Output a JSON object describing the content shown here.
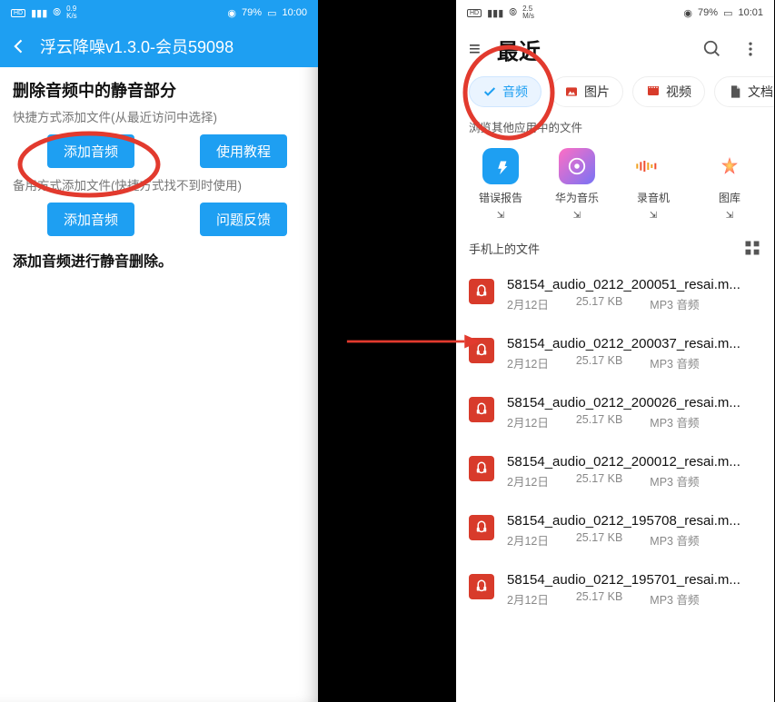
{
  "left_phone": {
    "status": {
      "speed_top": "0.9",
      "speed_bottom": "K/s",
      "battery": "79%",
      "time": "10:00"
    },
    "app_title": "浮云降噪v1.3.0-会员59098",
    "section_title": "删除音频中的静音部分",
    "hint1": "快捷方式添加文件(从最近访问中选择)",
    "btn_add1": "添加音频",
    "btn_tutorial": "使用教程",
    "hint2": "备用方式添加文件(快捷方式找不到时使用)",
    "btn_add2": "添加音频",
    "btn_feedback": "问题反馈",
    "instruction": "添加音频进行静音删除。"
  },
  "right_phone": {
    "status": {
      "speed_top": "2.5",
      "speed_bottom": "M/s",
      "battery": "79%",
      "time": "10:01"
    },
    "recent": "最近",
    "chips": {
      "audio": "音频",
      "image": "图片",
      "video": "视频",
      "doc": "文档"
    },
    "browse_apps": "浏览其他应用中的文件",
    "apps": {
      "bugreport": "错误报告",
      "hwmusic": "华为音乐",
      "recorder": "录音机",
      "gallery": "图库"
    },
    "files_on_phone": "手机上的文件",
    "files": [
      {
        "name": "58154_audio_0212_200051_resai.m...",
        "date": "2月12日",
        "size": "25.17 KB",
        "type": "MP3 音频"
      },
      {
        "name": "58154_audio_0212_200037_resai.m...",
        "date": "2月12日",
        "size": "25.17 KB",
        "type": "MP3 音频"
      },
      {
        "name": "58154_audio_0212_200026_resai.m...",
        "date": "2月12日",
        "size": "25.17 KB",
        "type": "MP3 音频"
      },
      {
        "name": "58154_audio_0212_200012_resai.m...",
        "date": "2月12日",
        "size": "25.17 KB",
        "type": "MP3 音频"
      },
      {
        "name": "58154_audio_0212_195708_resai.m...",
        "date": "2月12日",
        "size": "25.17 KB",
        "type": "MP3 音频"
      },
      {
        "name": "58154_audio_0212_195701_resai.m...",
        "date": "2月12日",
        "size": "25.17 KB",
        "type": "MP3 音频"
      }
    ]
  }
}
